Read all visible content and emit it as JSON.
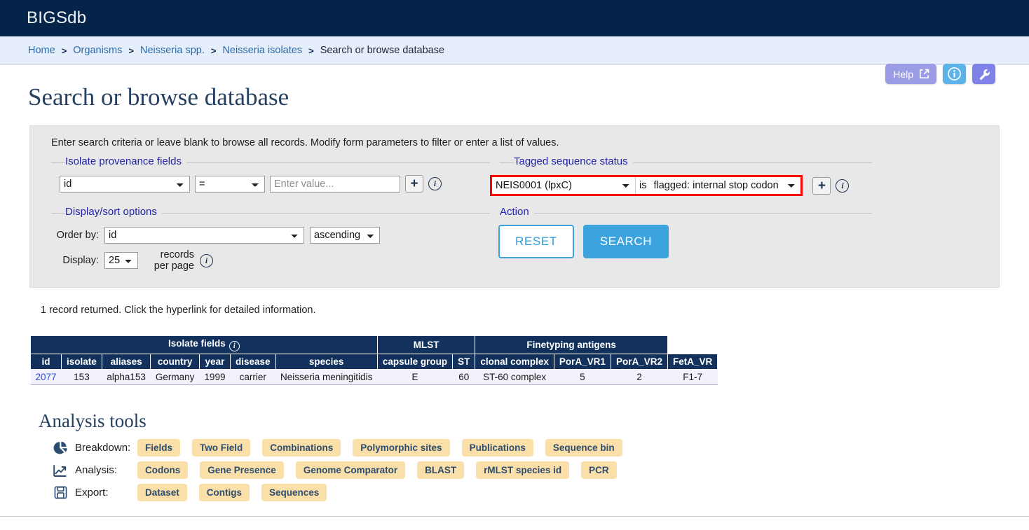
{
  "header": {
    "brand": "BIGSdb",
    "bg_color": "#052449"
  },
  "breadcrumb": {
    "separator": ">",
    "items": [
      {
        "label": "Home",
        "current": false
      },
      {
        "label": "Organisms",
        "current": false
      },
      {
        "label": "Neisseria spp.",
        "current": false
      },
      {
        "label": "Neisseria isolates",
        "current": false
      },
      {
        "label": "Search or browse database",
        "current": true
      }
    ]
  },
  "utility": {
    "help_label": "Help",
    "help_icon": "external-link-icon",
    "info_icon": "info-icon",
    "tool_icon": "wrench-icon",
    "help_color": "#9b9be6",
    "info_color": "#5bb3ea",
    "tool_color": "#7e82e8"
  },
  "page": {
    "title": "Search or browse database",
    "intro": "Enter search criteria or leave blank to browse all records. Modify form parameters to filter or enter a list of values."
  },
  "provenance": {
    "legend": "Isolate provenance fields",
    "field_value": "id",
    "operator_value": "=",
    "value_placeholder": "Enter value...",
    "value_current": "",
    "add_label": "+",
    "info_glyph": "i"
  },
  "tagged_status": {
    "legend": "Tagged sequence status",
    "locus_value": "NEIS0001 (lpxC)",
    "is_word": "is",
    "status_value": "flagged: internal stop codon",
    "add_label": "+",
    "info_glyph": "i",
    "highlight_color": "#ff0000"
  },
  "display_options": {
    "legend": "Display/sort options",
    "order_by_label": "Order by:",
    "order_by_value": "id",
    "direction_value": "ascending",
    "display_label": "Display:",
    "records_value": "25",
    "records_suffix": "records per page",
    "info_glyph": "i"
  },
  "action": {
    "legend": "Action",
    "reset_label": "RESET",
    "search_label": "SEARCH"
  },
  "results": {
    "summary": "1 record returned. Click the hyperlink for detailed information.",
    "group_headers": [
      {
        "label": "Isolate fields",
        "span": 7,
        "info": true
      },
      {
        "label": "MLST",
        "span": 2,
        "info": false
      },
      {
        "label": "Finetyping antigens",
        "span": 3,
        "info": false
      }
    ],
    "columns": [
      "id",
      "isolate",
      "aliases",
      "country",
      "year",
      "disease",
      "species",
      "capsule group",
      "ST",
      "clonal complex",
      "PorA_VR1",
      "PorA_VR2",
      "FetA_VR"
    ],
    "rows": [
      {
        "id": "2077",
        "isolate": "153",
        "aliases": "alpha153",
        "country": "Germany",
        "year": "1999",
        "disease": "carrier",
        "species": "Neisseria meningitidis",
        "capsule_group": "E",
        "ST": "60",
        "clonal_complex": "ST-60 complex",
        "PorA_VR1": "5",
        "PorA_VR2": "2",
        "FetA_VR": "F1-7"
      }
    ]
  },
  "analysis_tools": {
    "title": "Analysis tools",
    "rows": [
      {
        "icon": "pie-chart-icon",
        "label": "Breakdown:",
        "buttons": [
          "Fields",
          "Two Field",
          "Combinations",
          "Polymorphic sites",
          "Publications",
          "Sequence bin"
        ]
      },
      {
        "icon": "chart-line-icon",
        "label": "Analysis:",
        "buttons": [
          "Codons",
          "Gene Presence",
          "Genome Comparator",
          "BLAST",
          "rMLST species id",
          "PCR"
        ]
      },
      {
        "icon": "save-disk-icon",
        "label": "Export:",
        "buttons": [
          "Dataset",
          "Contigs",
          "Sequences"
        ]
      }
    ],
    "chip_color": "#fadfa8",
    "chip_text_color": "#2d4d70"
  }
}
